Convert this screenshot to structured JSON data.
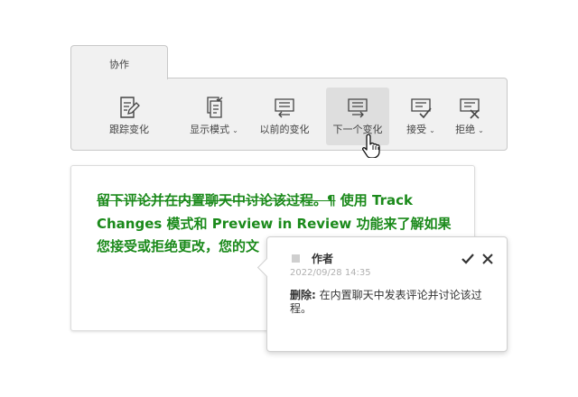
{
  "tab": {
    "label": "协作"
  },
  "toolbar": {
    "buttons": [
      {
        "label": "跟踪变化",
        "icon": "track-changes-icon",
        "has_dropdown": false
      },
      {
        "label": "显示模式",
        "icon": "display-mode-icon",
        "has_dropdown": true
      },
      {
        "label": "以前的变化",
        "icon": "previous-change-icon",
        "has_dropdown": false
      },
      {
        "label": "下一个变化",
        "icon": "next-change-icon",
        "has_dropdown": false,
        "hovered": true
      },
      {
        "label": "接受",
        "icon": "accept-icon",
        "has_dropdown": true
      },
      {
        "label": "拒绝",
        "icon": "reject-icon",
        "has_dropdown": true
      }
    ],
    "dropdown_glyph": "⌄"
  },
  "document": {
    "deleted_text": "留下评论并在内置聊天中讨论该过程。¶",
    "inserted_text": " 使用 Track Changes 模式和 Preview in Review 功能来了解如果您接受或拒绝更改，您的文"
  },
  "popup": {
    "author": "作者",
    "date": "2022/09/28 14:35",
    "label": "删除:",
    "content": " 在内置聊天中发表评论并讨论该过程。"
  },
  "colors": {
    "inserted_text": "#1b8a1b",
    "hover_bg": "#dedede",
    "panel_bg": "#f1f1f1"
  }
}
